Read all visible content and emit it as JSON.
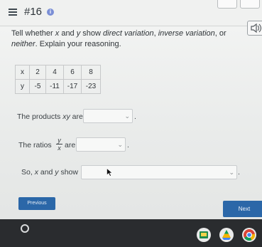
{
  "header": {
    "problem_number": "#16",
    "info_icon": "info-icon",
    "menu_icon": "hamburger-menu-icon"
  },
  "question": {
    "part1": "Tell whether ",
    "var_x": "x",
    "part2": " and ",
    "var_y": "y",
    "part3": " show ",
    "direct": "direct variation",
    "comma1": ", ",
    "inverse": "inverse variation",
    "comma2": ", or ",
    "neither": "neither",
    "part4": ". Explain your reasoning."
  },
  "table": {
    "rows": [
      {
        "label": "x",
        "values": [
          "2",
          "4",
          "6",
          "8"
        ]
      },
      {
        "label": "y",
        "values": [
          "-5",
          "-11",
          "-17",
          "-23"
        ]
      }
    ]
  },
  "products_row": {
    "text_before": "The products ",
    "expr": "xy",
    "text_after": " are",
    "period": "."
  },
  "ratios_row": {
    "text_before": "The ratios",
    "frac_num": "y",
    "frac_den": "x",
    "text_after": "are",
    "period": "."
  },
  "so_row": {
    "text_before": "So, ",
    "var_x": "x",
    "text_mid": " and ",
    "var_y": "y",
    "text_after": " show",
    "period": "."
  },
  "buttons": {
    "previous": "Previous",
    "next": "Next"
  },
  "colors": {
    "button_blue": "#2b67a8",
    "accent_purple": "#7b8fd6"
  }
}
